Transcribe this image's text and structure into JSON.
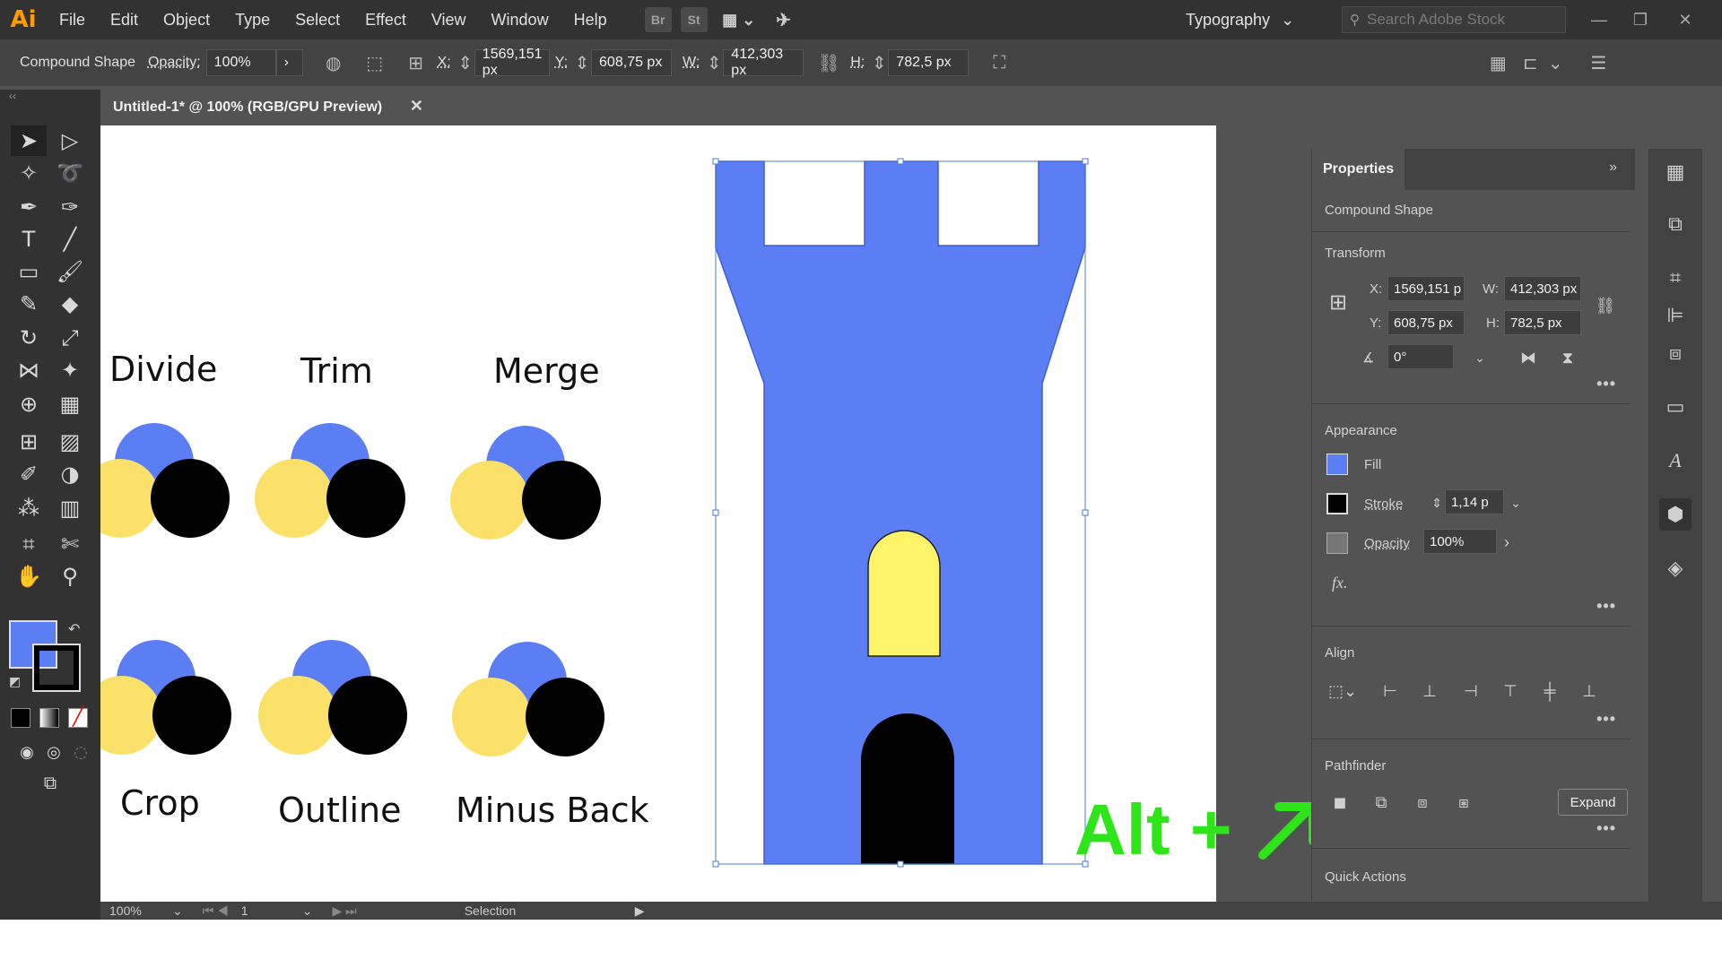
{
  "app": {
    "logo": "Ai"
  },
  "menu": [
    "File",
    "Edit",
    "Object",
    "Type",
    "Select",
    "Effect",
    "View",
    "Window",
    "Help"
  ],
  "appbar": {
    "bridge": "Br",
    "stock": "St"
  },
  "workspace": {
    "label": "Typography"
  },
  "search": {
    "placeholder": "Search Adobe Stock"
  },
  "control": {
    "object_type": "Compound Shape",
    "opacity_label": "Opacity:",
    "opacity_value": "100%",
    "x_label": "X:",
    "x_value": "1569,151 px",
    "y_label": "Y:",
    "y_value": "608,75 px",
    "w_label": "W:",
    "w_value": "412,303 px",
    "h_label": "H:",
    "h_value": "782,5 px"
  },
  "document": {
    "tab_title": "Untitled-1* @ 100% (RGB/GPU Preview)"
  },
  "canvas": {
    "labels": {
      "divide": "Divide",
      "trim": "Trim",
      "merge": "Merge",
      "crop": "Crop",
      "outline": "Outline",
      "minus_back": "Minus Back"
    },
    "hint": "Alt +",
    "colors": {
      "blue": "#5b7ef5",
      "yellow": "#fbe06a",
      "arch_yellow": "#fdf46a",
      "black": "#000000",
      "hint_green": "#2ee51a"
    }
  },
  "status": {
    "zoom": "100%",
    "artboard": "1",
    "tool": "Selection"
  },
  "properties": {
    "tab": "Properties",
    "object_type": "Compound Shape",
    "transform": {
      "title": "Transform",
      "x_label": "X:",
      "x_value": "1569,151 p",
      "y_label": "Y:",
      "y_value": "608,75 px",
      "w_label": "W:",
      "w_value": "412,303 px",
      "h_label": "H:",
      "h_value": "782,5 px",
      "angle_value": "0°"
    },
    "appearance": {
      "title": "Appearance",
      "fill_label": "Fill",
      "stroke_label": "Stroke",
      "stroke_value": "1,14 p",
      "opacity_label": "Opacity",
      "opacity_value": "100%",
      "fx": "fx."
    },
    "align": {
      "title": "Align"
    },
    "pathfinder": {
      "title": "Pathfinder",
      "expand_label": "Expand"
    },
    "quick_actions": {
      "title": "Quick Actions"
    }
  }
}
